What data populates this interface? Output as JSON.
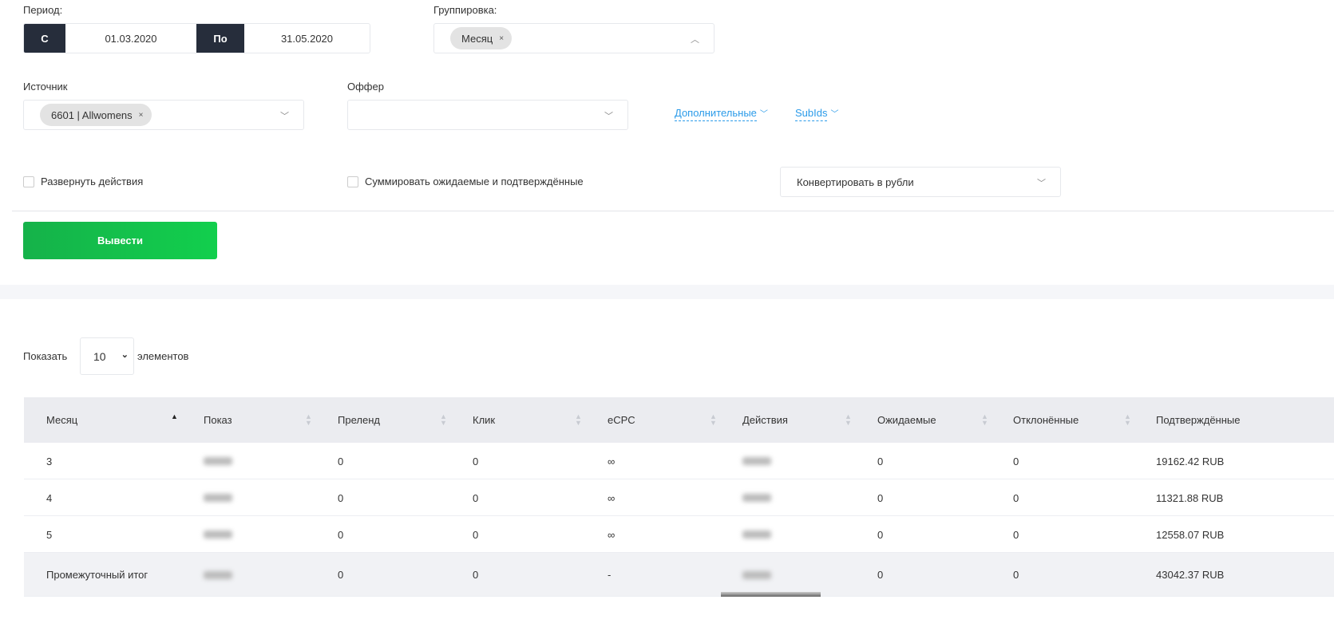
{
  "filters": {
    "period_label": "Период:",
    "from_label": "С",
    "from_value": "01.03.2020",
    "to_label": "По",
    "to_value": "31.05.2020",
    "grouping_label": "Группировка:",
    "grouping_chip": "Месяц",
    "source_label": "Источник",
    "source_chip": "6601 | Allwomens",
    "offer_label": "Оффер",
    "additional_link": "Дополнительные",
    "subids_link": "SubIds",
    "expand_actions": "Развернуть действия",
    "sum_expected": "Суммировать ожидаемые и подтверждённые",
    "convert_select": "Конвертировать в рубли",
    "submit": "Вывести"
  },
  "paging": {
    "show_label": "Показать",
    "page_size": "10",
    "elements_label": "элементов"
  },
  "table": {
    "columns": [
      "Месяц",
      "Показ",
      "Преленд",
      "Клик",
      "eCPC",
      "Действия",
      "Ожидаемые",
      "Отклонённые",
      "Подтверждённые"
    ],
    "rows": [
      {
        "month": "3",
        "prelend": "0",
        "click": "0",
        "ecpc": "∞",
        "expected": "0",
        "rejected": "0",
        "confirmed": "19162.42 RUB"
      },
      {
        "month": "4",
        "prelend": "0",
        "click": "0",
        "ecpc": "∞",
        "expected": "0",
        "rejected": "0",
        "confirmed": "11321.88 RUB"
      },
      {
        "month": "5",
        "prelend": "0",
        "click": "0",
        "ecpc": "∞",
        "expected": "0",
        "rejected": "0",
        "confirmed": "12558.07 RUB"
      }
    ],
    "subtotal": {
      "month": "Промежуточный итог",
      "prelend": "0",
      "click": "0",
      "ecpc": "-",
      "expected": "0",
      "rejected": "0",
      "confirmed": "43042.37 RUB"
    }
  },
  "colors": {
    "dark": "#262d3b",
    "green": "#12cf4d",
    "link": "#2b9be9"
  }
}
